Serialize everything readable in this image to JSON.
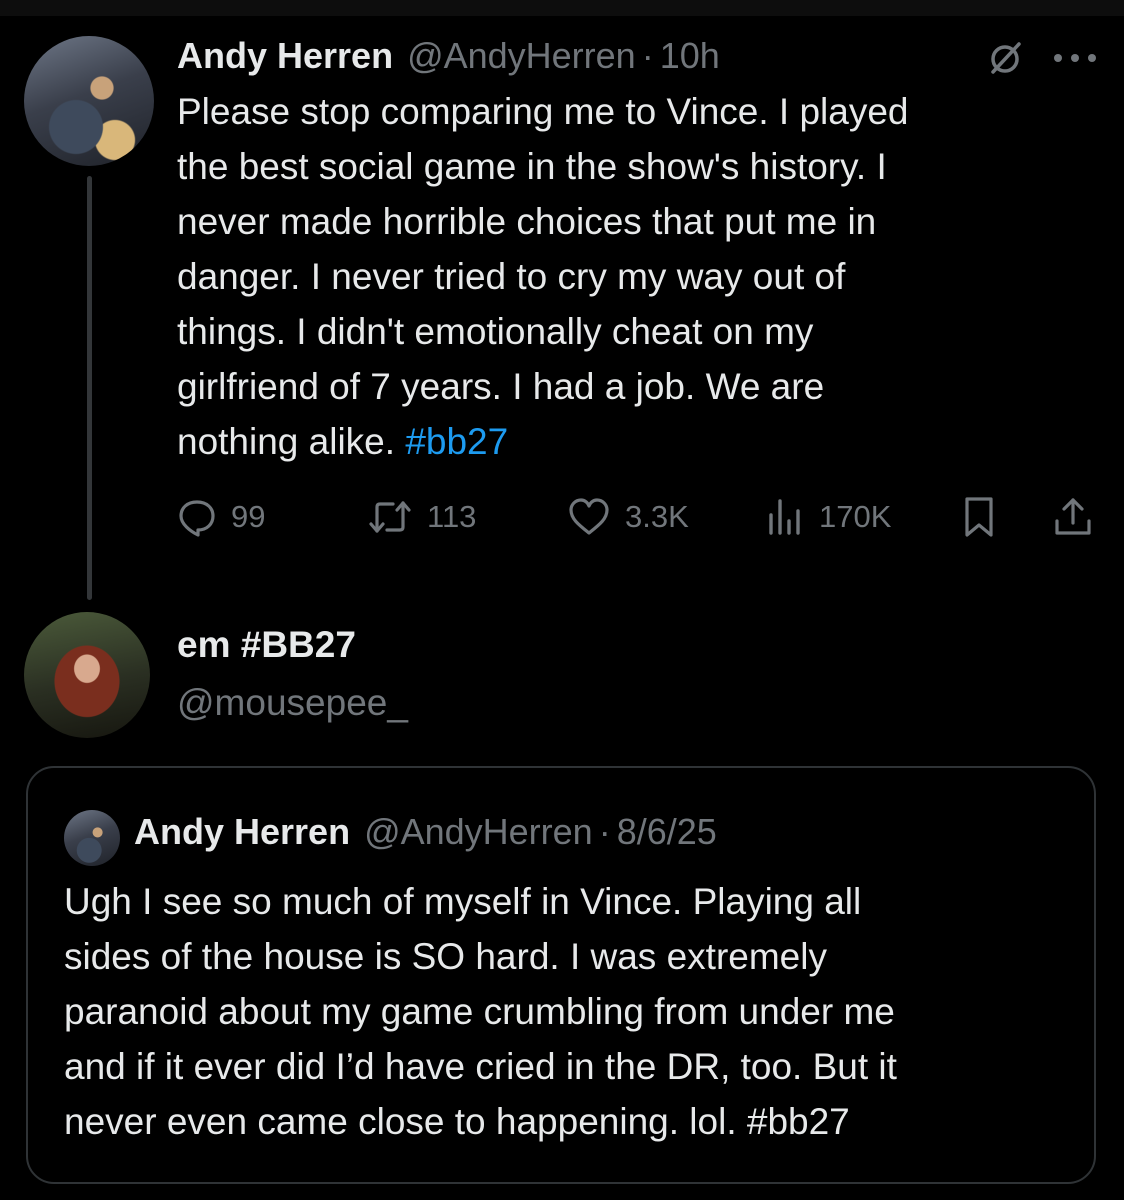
{
  "main_tweet": {
    "author_name": "Andy Herren",
    "author_handle": "@AndyHerren",
    "separator": "·",
    "time": "10h",
    "text": "Please stop comparing me to Vince. I played\nthe best social game in the show's history. I\nnever made horrible choices that put me in\ndanger. I never tried to cry my way out of\nthings. I didn't emotionally cheat on my\ngirlfriend of 7 years. I had a job. We are\nnothing alike. ",
    "hashtag": "#bb27",
    "metrics": {
      "replies": "99",
      "reposts": "113",
      "likes": "3.3K",
      "views": "170K"
    },
    "icons": [
      "grok-icon",
      "more-icon",
      "reply-icon",
      "repost-icon",
      "like-icon",
      "views-icon",
      "bookmark-icon",
      "share-icon"
    ]
  },
  "reply_tweet": {
    "author_name": "em #BB27",
    "author_handle": "@mousepee_"
  },
  "quoted_tweet": {
    "author_name": "Andy Herren",
    "author_handle": "@AndyHerren",
    "separator": "·",
    "date": "8/6/25",
    "text": "Ugh I see so much of myself in Vince. Playing all\nsides of the house is SO hard. I was extremely\nparanoid about my game crumbling from under me\nand if it ever did I’d have cried in the DR, too. But it\nnever even came close to happening. lol. #bb27"
  },
  "colors": {
    "background": "#000000",
    "text_primary": "#e7e9ea",
    "text_secondary": "#71767b",
    "hashtag": "#1d9bf0",
    "border": "#2f3336"
  }
}
